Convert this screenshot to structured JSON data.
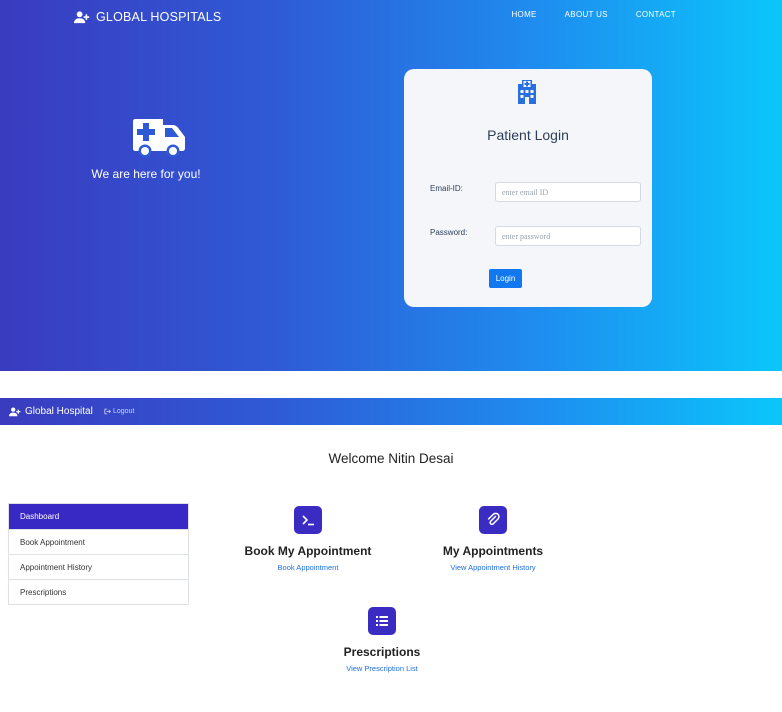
{
  "hero": {
    "brand": "GLOBAL HOSPITALS",
    "nav": [
      "HOME",
      "ABOUT US",
      "CONTACT"
    ],
    "tagline": "We are here for you!",
    "accent_gradient": [
      "#3a3bbf",
      "#0bc6fa"
    ]
  },
  "login": {
    "title": "Patient Login",
    "email_label": "Email-ID:",
    "email_placeholder": "enter email ID",
    "password_label": "Password:",
    "password_placeholder": "enter password",
    "button": "Login",
    "button_color": "#1178f0"
  },
  "dashboard": {
    "brand": "Global Hospital",
    "logout": "Logout",
    "welcome": "Welcome  Nitin Desai",
    "sidebar": [
      {
        "label": "Dashboard",
        "active": true
      },
      {
        "label": "Book Appointment",
        "active": false
      },
      {
        "label": "Appointment History",
        "active": false
      },
      {
        "label": "Prescriptions",
        "active": false
      }
    ],
    "cards": [
      {
        "icon": "terminal-icon",
        "title": "Book My Appointment",
        "link": "Book Appointment"
      },
      {
        "icon": "paperclip-icon",
        "title": "My Appointments",
        "link": "View Appointment History"
      },
      {
        "icon": "list-icon",
        "title": "Prescriptions",
        "link": "View Prescription List"
      }
    ],
    "accent": "#3a2cc3"
  }
}
